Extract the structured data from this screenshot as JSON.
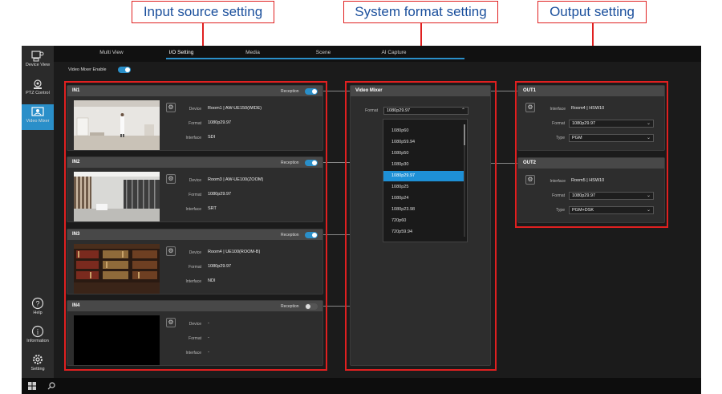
{
  "callouts": {
    "input": "Input source setting",
    "system": "System format setting",
    "output": "Output setting"
  },
  "sidebar": {
    "device_view": "Device View",
    "ptz_control": "PTZ Control",
    "video_mixer": "Video Mixer",
    "help": "Help",
    "information": "Information",
    "setting": "Setting"
  },
  "tabs": [
    "Multi View",
    "I/O Setting",
    "Media",
    "Scene",
    "AI Capture"
  ],
  "video_mixer_enable": "Video Mixer Enable",
  "labels": {
    "device": "Device",
    "format": "Format",
    "interface": "Interface",
    "type": "Type",
    "reception": "Reception"
  },
  "inputs": [
    {
      "title": "IN1",
      "device": "Room1 | AW-UE150(WIDE)",
      "format": "1080p29.97",
      "interface": "SDI",
      "reception": true
    },
    {
      "title": "IN2",
      "device": "Room3 | AW-UE100(ZOOM)",
      "format": "1080p29.97",
      "interface": "SRT",
      "reception": true
    },
    {
      "title": "IN3",
      "device": "Room4 | UE100(ROOM-B)",
      "format": "1080p29.97",
      "interface": "NDI",
      "reception": true
    },
    {
      "title": "IN4",
      "device": "-",
      "format": "-",
      "interface": "-",
      "reception": false
    }
  ],
  "mixer": {
    "title": "Video Mixer",
    "format_label": "Format",
    "format_value": "1080p29.97",
    "options": [
      "1080p60",
      "1080p59.94",
      "1080p50",
      "1080p30",
      "1080p29.97",
      "1080p25",
      "1080p24",
      "1080p23.98",
      "720p60",
      "720p59.94"
    ],
    "selected": "1080p29.97"
  },
  "outputs": [
    {
      "title": "OUT1",
      "interface": "Room4 | HSW10",
      "format": "1080p29.97",
      "type": "PGM"
    },
    {
      "title": "OUT2",
      "interface": "Room5 | HSW10",
      "format": "1080p29.97",
      "type": "PGM+DSK"
    }
  ],
  "colors": {
    "accent": "#2a8fc9",
    "highlight": "#e02020",
    "callout_text": "#1a4f9c"
  }
}
